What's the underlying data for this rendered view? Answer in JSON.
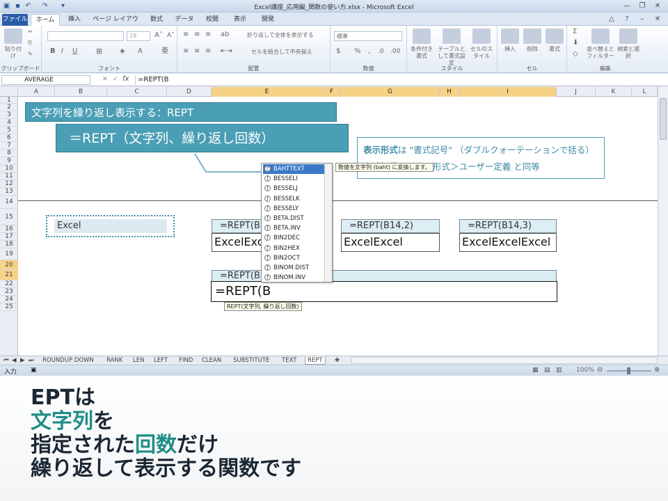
{
  "window": {
    "title": "Excel講座_応用編_関数の使い方.xlsx - Microsoft Excel"
  },
  "ribbon": {
    "tabs": [
      "ファイル",
      "ホーム",
      "挿入",
      "ページ レイアウト",
      "数式",
      "データ",
      "校閲",
      "表示",
      "開発"
    ],
    "groups": {
      "clipboard": "クリップボード",
      "font": "フォント",
      "alignment": "配置",
      "number": "数値",
      "style": "スタイル",
      "cells": "セル",
      "editing": "編集"
    },
    "paste": "貼り付け",
    "font_size": "18",
    "wrap_text": "折り返して全体を表示する",
    "merge_center": "セルを結合して中央揃え",
    "number_format": "標準",
    "cond_format": "条件付き書式",
    "table_format": "テーブルとして書式設定",
    "cell_style": "セルのスタイル",
    "insert": "挿入",
    "delete": "削除",
    "format": "書式",
    "sort_filter": "並べ替えとフィルター",
    "find_select": "検索と選択"
  },
  "formula_bar": {
    "name_box": "AVERAGE",
    "formula": "=REPT(B",
    "fx": "fx"
  },
  "columns": [
    "A",
    "B",
    "C",
    "D",
    "E",
    "F",
    "G",
    "H",
    "I",
    "J",
    "K",
    "L"
  ],
  "rows": [
    "1",
    "2",
    "3",
    "4",
    "5",
    "6",
    "7",
    "8",
    "9",
    "10",
    "11",
    "12",
    "13",
    "14",
    "15",
    "16",
    "17",
    "18",
    "19",
    "20",
    "21",
    "22",
    "23",
    "24",
    "25"
  ],
  "cells": {
    "b14": "Excel",
    "e14": "=REPT(B",
    "e15": "ExcelExc",
    "g14": "=REPT(B14,2)",
    "g15": "ExcelExcel",
    "i14": "=REPT(B14,3)",
    "i15": "ExcelExcelExcel",
    "e19": "=REPT(B1",
    "e20": "=REPT(B"
  },
  "callouts": {
    "title": "文字列を繰り返し表示する：REPT",
    "syntax": "＝REPT（文字列、繰り返し回数）",
    "note_bold": "表示形式",
    "note_line1": "は \"書式記号\" （ダブルクォーテーションで括る）",
    "note_line2": "書式記号は＜表示形式＞ユーザー定義 と同等"
  },
  "autocomplete": {
    "items": [
      "BAHTTEXT",
      "BESSELI",
      "BESSELJ",
      "BESSELK",
      "BESSELY",
      "BETA.DIST",
      "BETA.INV",
      "BIN2DEC",
      "BIN2HEX",
      "BIN2OCT",
      "BINOM.DIST",
      "BINOM.INV"
    ],
    "selected": 0,
    "tooltip": "数値を文字列 (baht) に変換します。",
    "arg_hint": "REPT(文字列, 繰り返し回数)"
  },
  "sheets": [
    "ROUNDUP DOWN",
    "RANK",
    "LEN",
    "LEFT",
    "FIND",
    "CLEAN",
    "SUBSTITUTE",
    "TEXT",
    "REPT"
  ],
  "active_sheet": "REPT",
  "status": {
    "mode": "入力",
    "zoom": "100%"
  },
  "caption": {
    "line1": "EPTは",
    "line2_hl": "文字列",
    "line2_rest": "を",
    "line3_a": "指定された",
    "line3_hl": "回数",
    "line3_b": "だけ",
    "line4": "繰り返して表示する関数です"
  },
  "colors": {
    "accent": "#4a9eb5",
    "highlight": "#1f8e86",
    "selected": "#f6d287"
  }
}
